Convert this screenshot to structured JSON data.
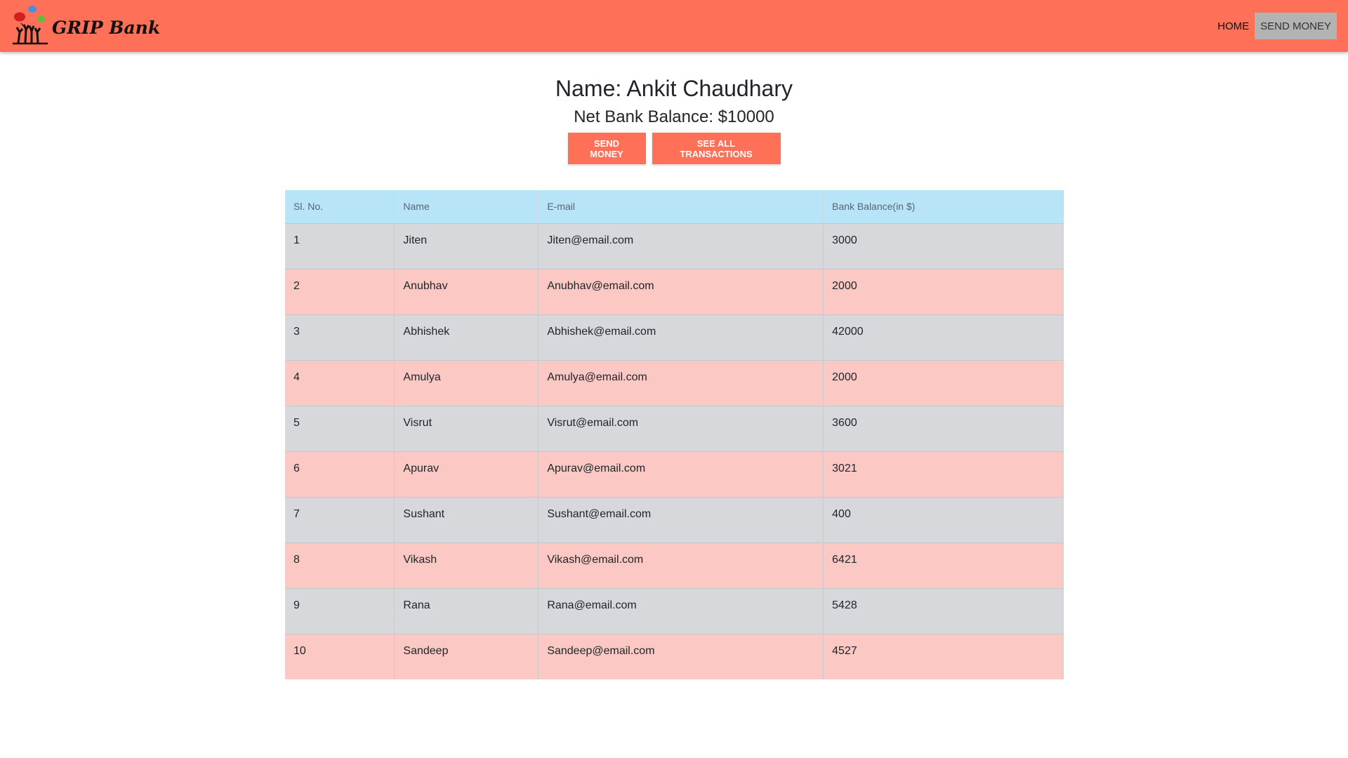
{
  "header": {
    "brand": "GRIP Bank",
    "nav": {
      "home": "HOME",
      "send_money": "SEND MONEY"
    }
  },
  "customer": {
    "name_line": "Name: Ankit Chaudhary",
    "balance_line": "Net Bank Balance: $10000"
  },
  "actions": {
    "send_money": "SEND MONEY",
    "see_all": "SEE ALL TRANSACTIONS"
  },
  "table": {
    "headers": [
      "Sl. No.",
      "Name",
      "E-mail",
      "Bank Balance(in $)"
    ],
    "rows": [
      [
        "1",
        "Jiten",
        "Jiten@email.com",
        "3000"
      ],
      [
        "2",
        "Anubhav",
        "Anubhav@email.com",
        "2000"
      ],
      [
        "3",
        "Abhishek",
        "Abhishek@email.com",
        "42000"
      ],
      [
        "4",
        "Amulya",
        "Amulya@email.com",
        "2000"
      ],
      [
        "5",
        "Visrut",
        "Visrut@email.com",
        "3600"
      ],
      [
        "6",
        "Apurav",
        "Apurav@email.com",
        "3021"
      ],
      [
        "7",
        "Sushant",
        "Sushant@email.com",
        "400"
      ],
      [
        "8",
        "Vikash",
        "Vikash@email.com",
        "6421"
      ],
      [
        "9",
        "Rana",
        "Rana@email.com",
        "5428"
      ],
      [
        "10",
        "Sandeep",
        "Sandeep@email.com",
        "4527"
      ]
    ]
  },
  "colors": {
    "accent": "#ff7058",
    "header_row": "#b8e4f8",
    "row_gray": "#d6d8dc",
    "row_pink": "#fcc8c4"
  }
}
